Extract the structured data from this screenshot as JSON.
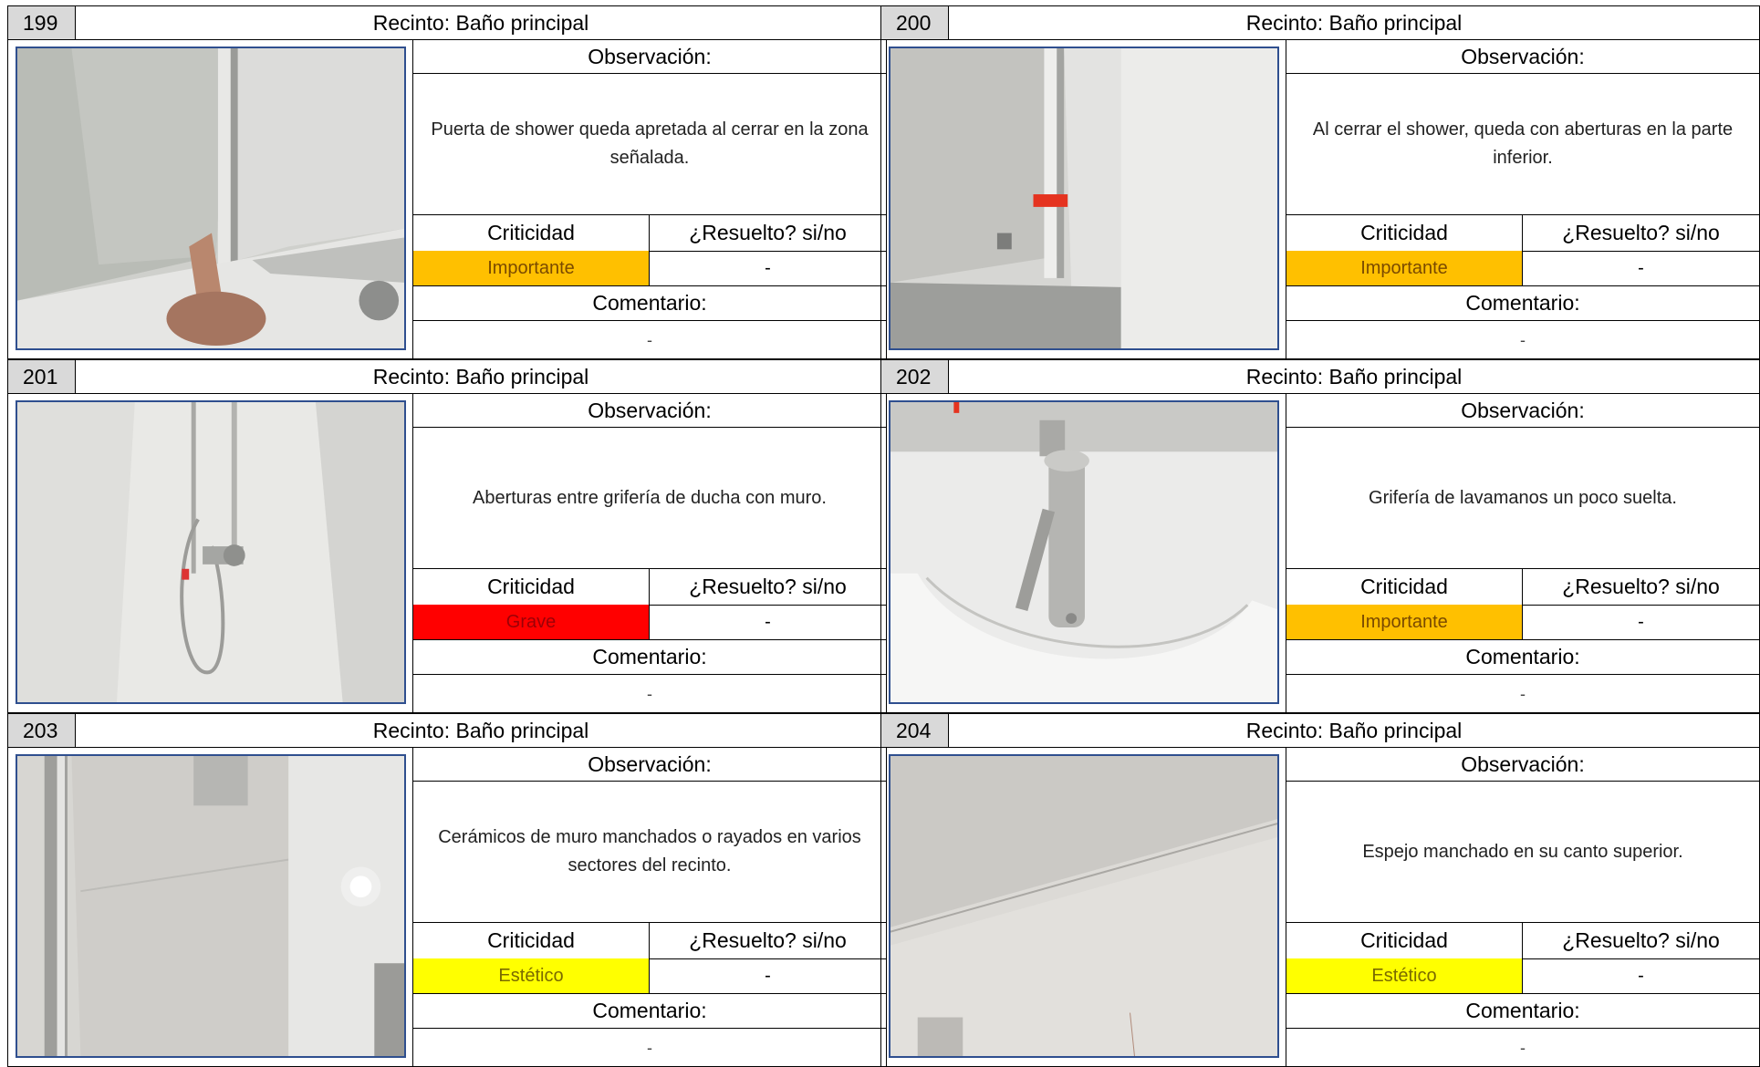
{
  "labels": {
    "observacion": "Observación:",
    "criticidad": "Criticidad",
    "resuelto": "¿Resuelto? si/no",
    "comentario": "Comentario:"
  },
  "cards": [
    {
      "number": "199",
      "recinto": "Recinto: Baño principal",
      "observacion": "Puerta de shower queda apretada al cerrar en la zona señalada.",
      "criticidad": "Importante",
      "criticidad_color": "#ffc000",
      "criticidad_text_color": "#7a4a00",
      "resuelto": "-",
      "comentario": "-"
    },
    {
      "number": "200",
      "recinto": "Recinto: Baño principal",
      "observacion": "Al cerrar el shower, queda con aberturas en la parte inferior.",
      "criticidad": "Importante",
      "criticidad_color": "#ffc000",
      "criticidad_text_color": "#7a4a00",
      "resuelto": "-",
      "comentario": "-"
    },
    {
      "number": "201",
      "recinto": "Recinto: Baño principal",
      "observacion": "Aberturas entre grifería de ducha con muro.",
      "criticidad": "Grave",
      "criticidad_color": "#ff0000",
      "criticidad_text_color": "#9c0006",
      "resuelto": "-",
      "comentario": "-"
    },
    {
      "number": "202",
      "recinto": "Recinto: Baño principal",
      "observacion": "Grifería de lavamanos un poco suelta.",
      "criticidad": "Importante",
      "criticidad_color": "#ffc000",
      "criticidad_text_color": "#7a4a00",
      "resuelto": "-",
      "comentario": "-"
    },
    {
      "number": "203",
      "recinto": "Recinto: Baño principal",
      "observacion": "Cerámicos de muro manchados o rayados en varios sectores del recinto.",
      "criticidad": "Estético",
      "criticidad_color": "#ffff00",
      "criticidad_text_color": "#7a6a00",
      "resuelto": "-",
      "comentario": "-"
    },
    {
      "number": "204",
      "recinto": "Recinto: Baño principal",
      "observacion": "Espejo manchado en su canto superior.",
      "criticidad": "Estético",
      "criticidad_color": "#ffff00",
      "criticidad_text_color": "#7a6a00",
      "resuelto": "-",
      "comentario": "-"
    }
  ]
}
